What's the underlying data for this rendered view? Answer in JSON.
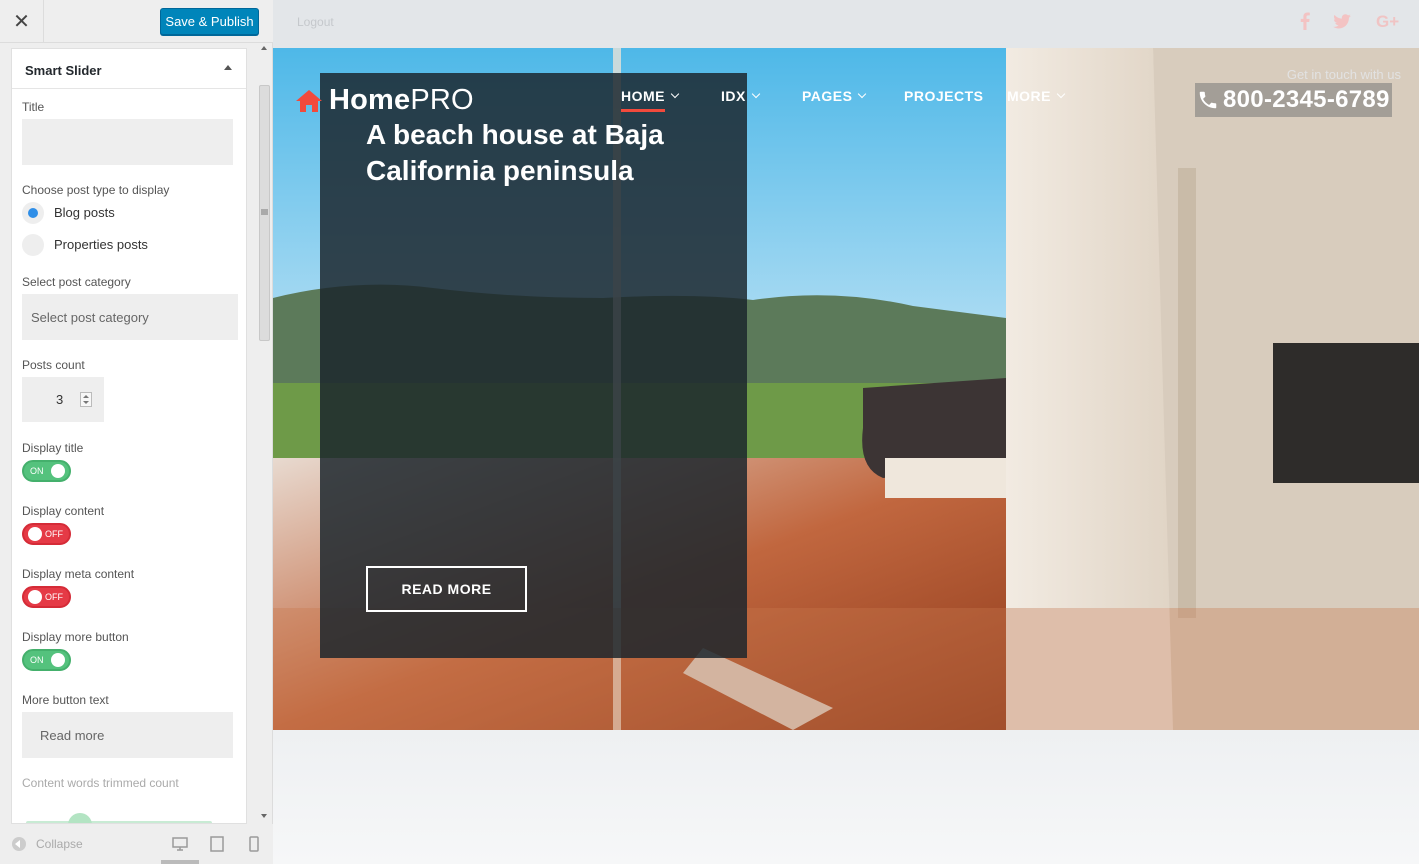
{
  "sidebar": {
    "close_icon": "close-icon",
    "save_label": "Save & Publish",
    "section_title": "Smart Slider",
    "fields": {
      "title_label": "Title",
      "title_value": "",
      "post_type_label": "Choose post type to display",
      "post_type_options": [
        "Blog posts",
        "Properties posts"
      ],
      "post_type_selected": "Blog posts",
      "category_label": "Select post category",
      "category_placeholder": "Select post category",
      "posts_count_label": "Posts count",
      "posts_count_value": "3",
      "display_title_label": "Display title",
      "display_title_state": "ON",
      "display_content_label": "Display content",
      "display_content_state": "OFF",
      "display_meta_label": "Display meta content",
      "display_meta_state": "OFF",
      "display_more_label": "Display more button",
      "display_more_state": "ON",
      "more_text_label": "More button text",
      "more_text_value": "Read more",
      "trim_label": "Content words trimmed count"
    },
    "footer": {
      "collapse_label": "Collapse"
    }
  },
  "preview": {
    "logout": "Logout",
    "logo": {
      "bold": "Home",
      "light": "PRO"
    },
    "nav": [
      {
        "label": "HOME",
        "has_dropdown": true,
        "active": true
      },
      {
        "label": "IDX",
        "has_dropdown": true,
        "active": false
      },
      {
        "label": "PAGES",
        "has_dropdown": true,
        "active": false
      },
      {
        "label": "PROJECTS",
        "has_dropdown": false,
        "active": false
      },
      {
        "label": "MORE",
        "has_dropdown": true,
        "active": false
      }
    ],
    "contact": {
      "tagline": "Get in touch with us",
      "phone": "800-2345-6789"
    },
    "slide": {
      "title": "A beach house at Baja California peninsula",
      "button": "READ MORE"
    },
    "social_icons": [
      "facebook-icon",
      "twitter-icon",
      "google-plus-icon"
    ]
  },
  "colors": {
    "accent": "#0085ba",
    "brand_red": "#f24a3c",
    "toggle_on": "#54c27d",
    "toggle_off": "#e53a46"
  }
}
